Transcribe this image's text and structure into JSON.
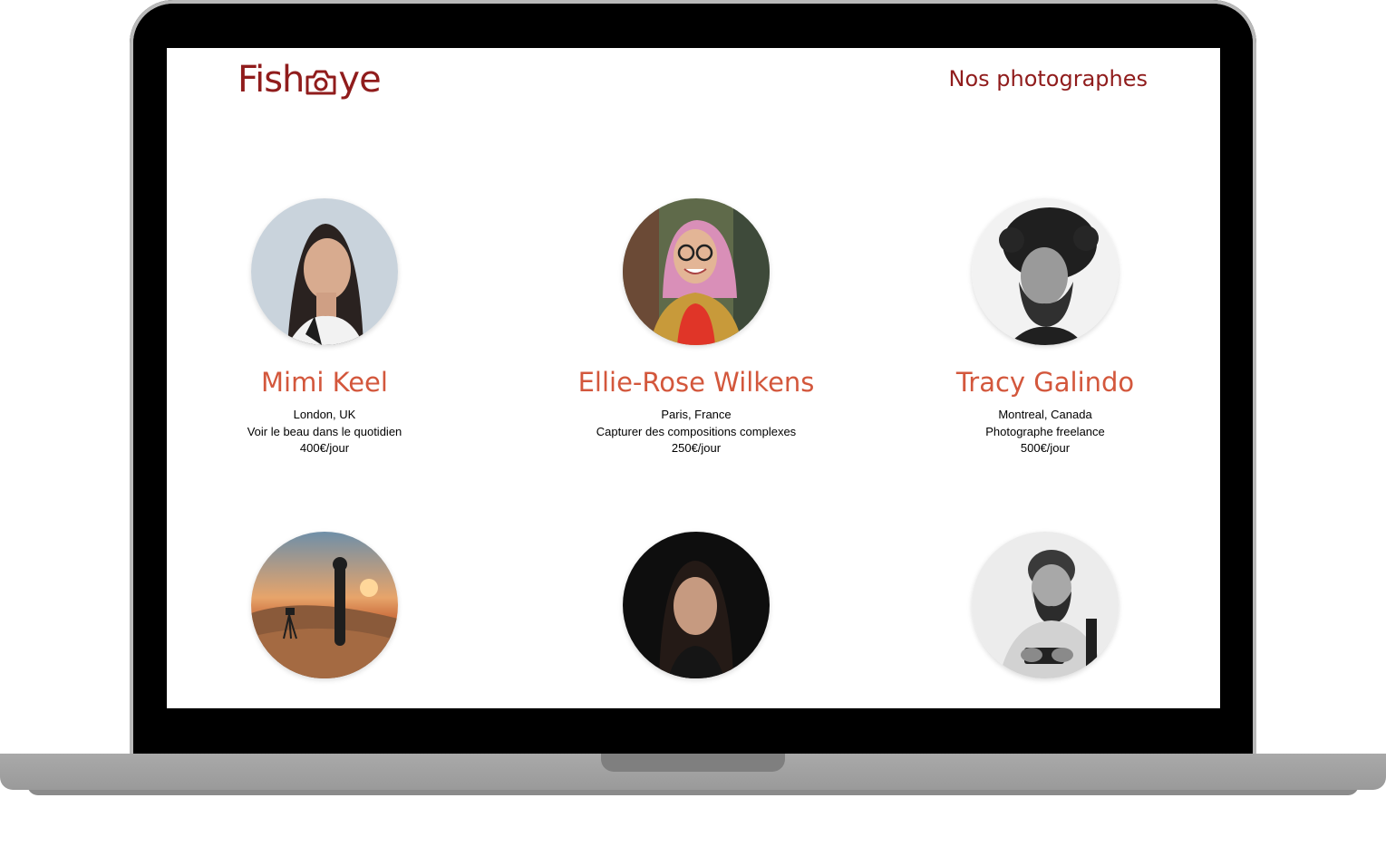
{
  "header": {
    "logo_text_left": "Fish",
    "logo_text_right": "ye",
    "logo_icon": "camera-icon",
    "nav_title": "Nos photographes"
  },
  "colors": {
    "brand": "#901c1c",
    "name_accent": "#d3573c"
  },
  "photographers": [
    {
      "name": "Mimi Keel",
      "location": "London, UK",
      "tagline": "Voir le beau dans le quotidien",
      "price": "400€/jour"
    },
    {
      "name": "Ellie-Rose Wilkens",
      "location": "Paris, France",
      "tagline": "Capturer des compositions complexes",
      "price": "250€/jour"
    },
    {
      "name": "Tracy Galindo",
      "location": "Montreal, Canada",
      "tagline": "Photographe freelance",
      "price": "500€/jour"
    },
    {
      "name": "",
      "location": "",
      "tagline": "",
      "price": ""
    },
    {
      "name": "",
      "location": "",
      "tagline": "",
      "price": ""
    },
    {
      "name": "",
      "location": "",
      "tagline": "",
      "price": ""
    }
  ]
}
